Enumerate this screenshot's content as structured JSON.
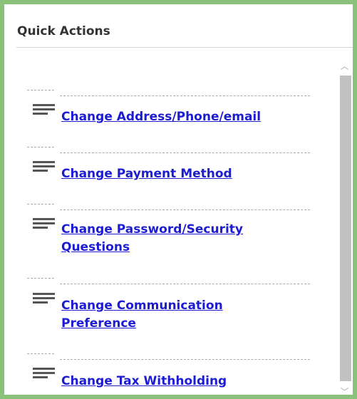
{
  "panel": {
    "title": "Quick Actions"
  },
  "actions": [
    {
      "label": "Change Address/Phone/email",
      "icon": "hamburger-menu-icon"
    },
    {
      "label": "Change Payment Method",
      "icon": "hamburger-menu-icon"
    },
    {
      "label": "Change Password/Security Questions",
      "icon": "hamburger-menu-icon"
    },
    {
      "label": "Change Communication Preference",
      "icon": "hamburger-menu-icon"
    },
    {
      "label": "Change Tax Withholding",
      "icon": "hamburger-menu-icon"
    }
  ],
  "scrollbar": {
    "up_glyph": "︿",
    "down_glyph": "﹀"
  },
  "colors": {
    "border": "#8bc27b",
    "link": "#1c1cd0",
    "thumb": "#c1c1c1"
  }
}
